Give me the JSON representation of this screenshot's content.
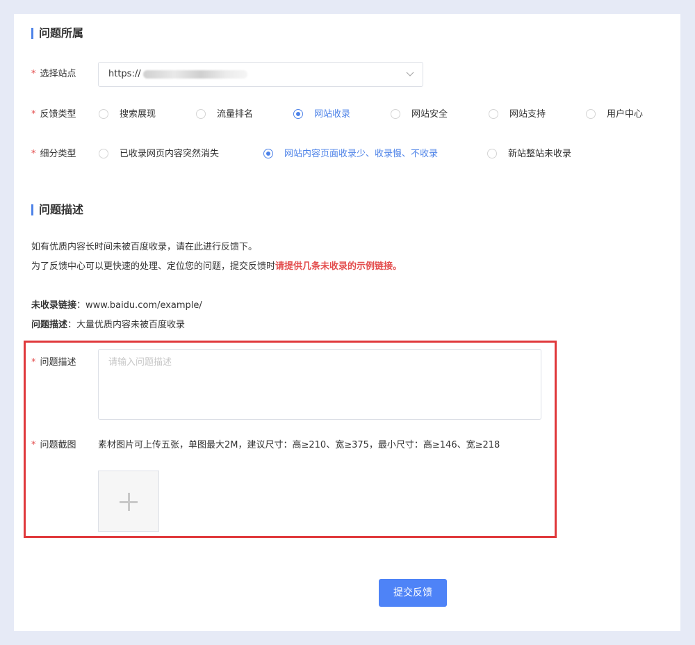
{
  "section1": {
    "title": "问题所属"
  },
  "site": {
    "label": "选择站点",
    "value_prefix": "https://"
  },
  "feedback_type": {
    "label": "反馈类型",
    "options": [
      "搜索展现",
      "流量排名",
      "网站收录",
      "网站安全",
      "网站支持",
      "用户中心"
    ],
    "selected": "网站收录"
  },
  "sub_type": {
    "label": "细分类型",
    "options": [
      "已收录网页内容突然消失",
      "网站内容页面收录少、收录慢、不收录",
      "新站整站未收录"
    ],
    "selected": "网站内容页面收录少、收录慢、不收录"
  },
  "section2": {
    "title": "问题描述"
  },
  "intro": {
    "line1": "如有优质内容长时间未被百度收录，请在此进行反馈下。",
    "line2_prefix": "为了反馈中心可以更快速的处理、定位您的问题，提交反馈时",
    "line2_highlight": "请提供几条未收录的示例链接。"
  },
  "example": {
    "link_label": "未收录链接",
    "link_value": "：www.baidu.com/example/",
    "desc_label": "问题描述",
    "desc_value": "：大量优质内容未被百度收录"
  },
  "description": {
    "label": "问题描述",
    "placeholder": "请输入问题描述"
  },
  "screenshot": {
    "label": "问题截图",
    "hint": "素材图片可上传五张，单图最大2M，建议尺寸：高≥210、宽≥375，最小尺寸：高≥146、宽≥218"
  },
  "submit_label": "提交反馈",
  "required_mark": "*",
  "colors": {
    "accent": "#4e83e8",
    "highlight": "#e34d4d",
    "box": "#e0393c"
  }
}
